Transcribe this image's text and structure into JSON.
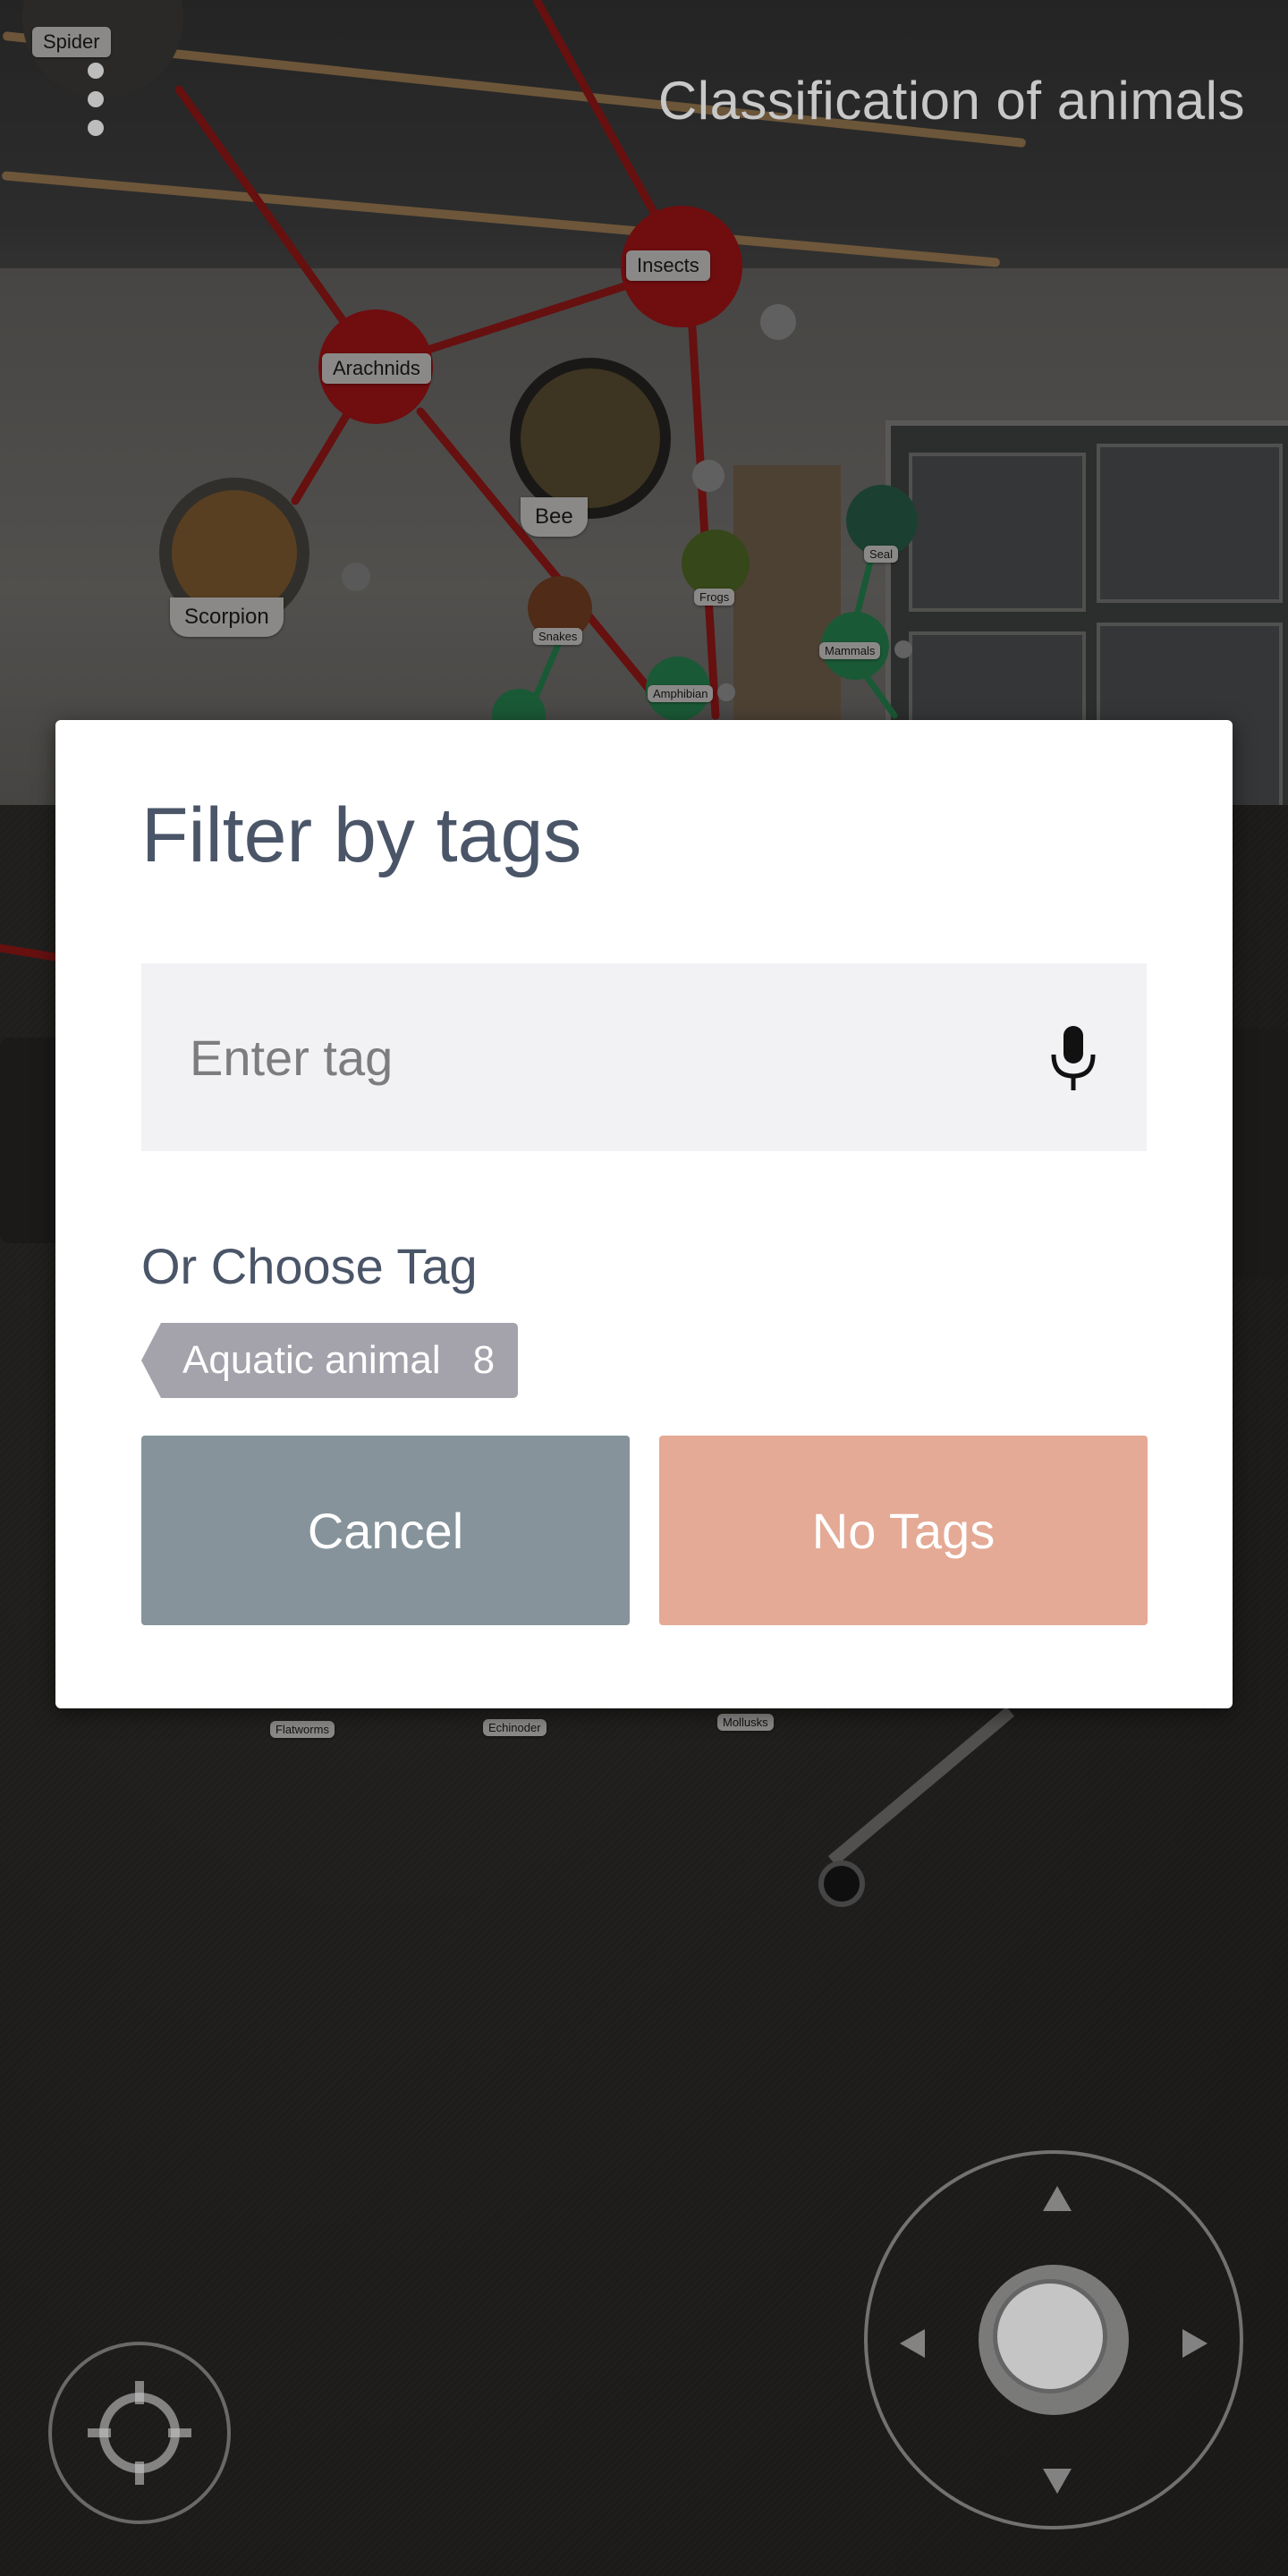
{
  "header": {
    "title": "Classification of animals"
  },
  "graph": {
    "nodes": {
      "spider": "Spider",
      "insects": "Insects",
      "arachnids": "Arachnids",
      "bee": "Bee",
      "scorpion": "Scorpion",
      "snakes": "Snakes",
      "frogs": "Frogs",
      "amphibian": "Amphibian",
      "seal": "Seal",
      "mammals": "Mammals",
      "flatworms": "Flatworms",
      "echinoder": "Echinoder",
      "mollusks": "Mollusks"
    },
    "colors": {
      "red_link": "#b01c1c",
      "green_link": "#2e9a5e"
    }
  },
  "dialog": {
    "title": "Filter by tags",
    "input": {
      "placeholder": "Enter tag",
      "value": ""
    },
    "mic_icon": "microphone-icon",
    "choose_label": "Or Choose Tag",
    "tags": [
      {
        "label": "Aquatic animal",
        "count": "8"
      }
    ],
    "buttons": {
      "cancel": "Cancel",
      "no_tags": "No Tags"
    },
    "colors": {
      "cancel_bg": "#86939b",
      "no_tags_bg": "#e4aa95",
      "chip_bg": "#a4a2ab",
      "title_color": "#4a5568"
    }
  },
  "controls": {
    "recenter_icon": "crosshair-icon",
    "joystick_icons": [
      "arrow-up-icon",
      "arrow-down-icon",
      "arrow-left-icon",
      "arrow-right-icon"
    ]
  }
}
